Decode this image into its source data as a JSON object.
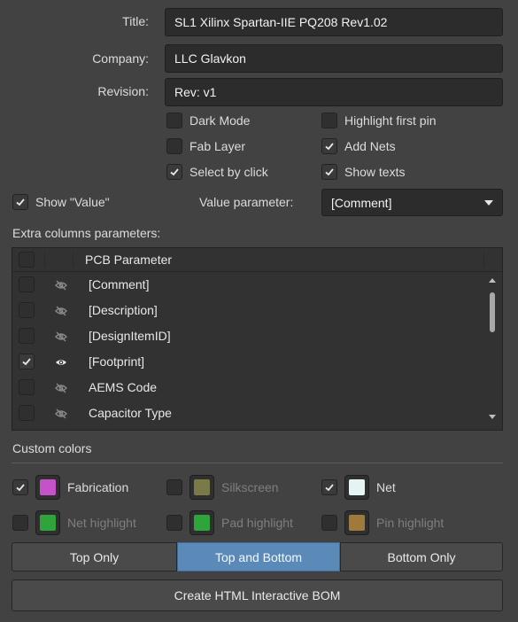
{
  "form": {
    "title_label": "Title:",
    "title_value": "SL1 Xilinx Spartan-IIE PQ208 Rev1.02",
    "company_label": "Company:",
    "company_value": "LLC Glavkon",
    "revision_label": "Revision:",
    "revision_value": "Rev: v1"
  },
  "options": {
    "dark_mode": {
      "label": "Dark Mode",
      "checked": false
    },
    "highlight_first_pin": {
      "label": "Highlight first pin",
      "checked": false
    },
    "fab_layer": {
      "label": "Fab Layer",
      "checked": false
    },
    "add_nets": {
      "label": "Add Nets",
      "checked": true
    },
    "select_by_click": {
      "label": "Select by click",
      "checked": true
    },
    "show_texts": {
      "label": "Show texts",
      "checked": true
    },
    "show_value": {
      "label": "Show \"Value\"",
      "checked": true
    }
  },
  "value_parameter": {
    "label": "Value parameter:",
    "selected": "[Comment]"
  },
  "extra_columns": {
    "label": "Extra columns parameters:",
    "header": "PCB Parameter",
    "rows": [
      {
        "name": "[Comment]",
        "checked": false,
        "visible": false
      },
      {
        "name": "[Description]",
        "checked": false,
        "visible": false
      },
      {
        "name": "[DesignItemID]",
        "checked": false,
        "visible": false
      },
      {
        "name": "[Footprint]",
        "checked": true,
        "visible": true
      },
      {
        "name": "AEMS Code",
        "checked": false,
        "visible": false
      },
      {
        "name": "Capacitor Type",
        "checked": false,
        "visible": false
      }
    ]
  },
  "custom_colors": {
    "label": "Custom colors",
    "items": [
      {
        "label": "Fabrication",
        "checked": true,
        "color": "#c552c8"
      },
      {
        "label": "Silkscreen",
        "checked": false,
        "color": "#7a7a48"
      },
      {
        "label": "Net",
        "checked": true,
        "color": "#e4f4f2"
      },
      {
        "label": "Net highlight",
        "checked": false,
        "color": "#2fa43a"
      },
      {
        "label": "Pad highlight",
        "checked": false,
        "color": "#2fa43a"
      },
      {
        "label": "Pin highlight",
        "checked": false,
        "color": "#a07a3a"
      }
    ]
  },
  "layer_buttons": {
    "top_only": "Top Only",
    "top_and_bottom": "Top and Bottom",
    "bottom_only": "Bottom Only",
    "selected": "top_and_bottom"
  },
  "create_button": "Create HTML Interactive BOM",
  "colors": {
    "background": "#424242",
    "field": "#2c2c2c",
    "selected_button": "#5c8ab8"
  }
}
